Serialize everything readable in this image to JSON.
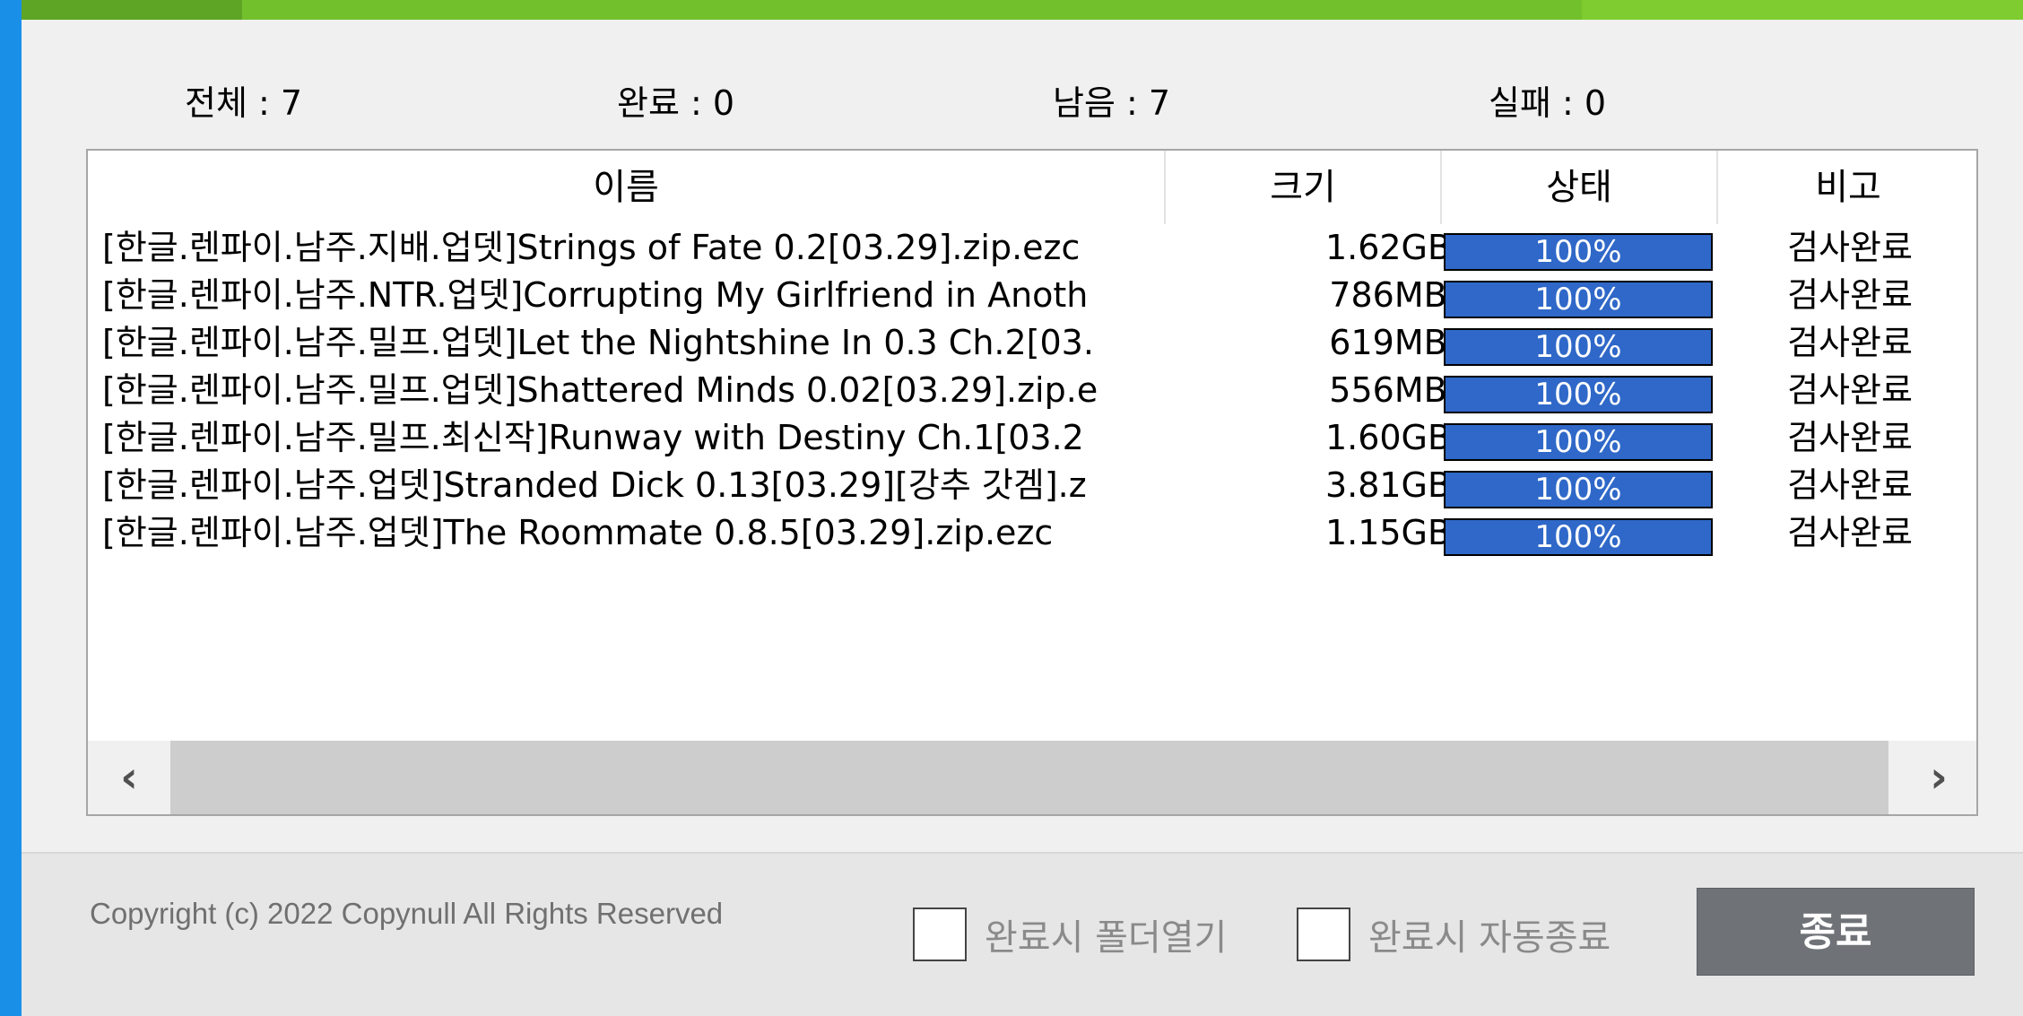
{
  "stats": {
    "total": "전체 : 7",
    "done": "완료 : 0",
    "remaining": "남음 : 7",
    "failed": "실패 : 0"
  },
  "columns": {
    "name": "이름",
    "size": "크기",
    "status": "상태",
    "note": "비고"
  },
  "files": [
    {
      "name": "[한글.렌파이.남주.지배.업뎃]Strings of Fate 0.2[03.29].zip.ezc",
      "size": "1.62GB",
      "progress": 100,
      "progress_label": "100%",
      "note": "검사완료"
    },
    {
      "name": "[한글.렌파이.남주.NTR.업뎃]Corrupting My Girlfriend in Anoth",
      "size": "786MB",
      "progress": 100,
      "progress_label": "100%",
      "note": "검사완료"
    },
    {
      "name": "[한글.렌파이.남주.밀프.업뎃]Let the Nightshine In 0.3 Ch.2[03.",
      "size": "619MB",
      "progress": 100,
      "progress_label": "100%",
      "note": "검사완료"
    },
    {
      "name": "[한글.렌파이.남주.밀프.업뎃]Shattered Minds 0.02[03.29].zip.e",
      "size": "556MB",
      "progress": 100,
      "progress_label": "100%",
      "note": "검사완료"
    },
    {
      "name": "[한글.렌파이.남주.밀프.최신작]Runway with Destiny Ch.1[03.2",
      "size": "1.60GB",
      "progress": 100,
      "progress_label": "100%",
      "note": "검사완료"
    },
    {
      "name": "[한글.렌파이.남주.업뎃]Stranded Dick 0.13[03.29][강추 갓겜].z",
      "size": "3.81GB",
      "progress": 100,
      "progress_label": "100%",
      "note": "검사완료"
    },
    {
      "name": "[한글.렌파이.남주.업뎃]The Roommate 0.8.5[03.29].zip.ezc",
      "size": "1.15GB",
      "progress": 100,
      "progress_label": "100%",
      "note": "검사완료"
    }
  ],
  "footer": {
    "copyright": "Copyright (c) 2022 Copynull All Rights Reserved",
    "open_folder_label": "완료시 폴더열기",
    "auto_exit_label": "완료시 자동종료",
    "exit_label": "종료"
  },
  "colors": {
    "accent_green": "#72c12c",
    "progress_blue": "#2f68c8",
    "button_gray": "#6f7378"
  }
}
